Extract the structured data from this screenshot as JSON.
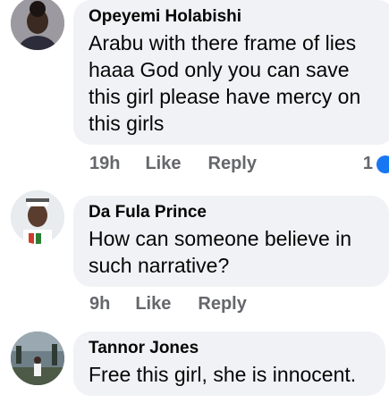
{
  "comments": [
    {
      "author": "Opeyemi Holabishi",
      "text": "Arabu with there frame of lies\nhaaa God only you can save\nthis girl  please have mercy on\nthis girls",
      "time": "19h",
      "like_label": "Like",
      "reply_label": "Reply",
      "reaction_count": "1"
    },
    {
      "author": "Da Fula Prince",
      "text": "How can someone believe in\nsuch narrative?",
      "time": "9h",
      "like_label": "Like",
      "reply_label": "Reply"
    },
    {
      "author": "Tannor Jones",
      "text": "Free this girl, she is innocent."
    }
  ]
}
